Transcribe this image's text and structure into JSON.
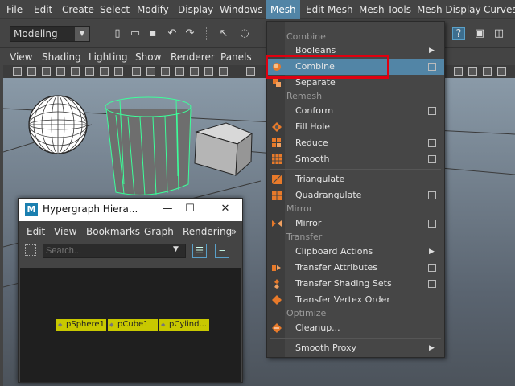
{
  "menubar": {
    "items": [
      "File",
      "Edit",
      "Create",
      "Select",
      "Modify",
      "Display",
      "Windows",
      "Mesh",
      "Edit Mesh",
      "Mesh Tools",
      "Mesh Display",
      "Curves"
    ],
    "active": "Mesh",
    "active_color": "#5285a6"
  },
  "toolbar": {
    "mode": "Modeling",
    "icons": [
      "new-scene-icon",
      "open-scene-icon",
      "save-scene-icon",
      "undo-icon",
      "redo-icon",
      "select-icon",
      "lasso-icon",
      "help-icon",
      "lock-icon"
    ]
  },
  "panel_menu": {
    "items": [
      "View",
      "Shading",
      "Lighting",
      "Show",
      "Renderer",
      "Panels"
    ]
  },
  "hypergraph": {
    "title": "Hypergraph Hiera...",
    "menu": [
      "Edit",
      "View",
      "Bookmarks",
      "Graph",
      "Rendering"
    ],
    "more": "»",
    "search_placeholder": "Search...",
    "nodes": [
      "pSphere1",
      "pCube1",
      "pCylind..."
    ],
    "node_color": "#c8c800"
  },
  "mesh_menu": {
    "sections": [
      {
        "title": "Combine",
        "items": [
          {
            "label": "Booleans",
            "option_box": false,
            "submenu": true,
            "icon": ""
          },
          {
            "label": "Combine",
            "option_box": true,
            "submenu": false,
            "icon": "combine-icon",
            "highlighted": true
          },
          {
            "label": "Separate",
            "option_box": false,
            "submenu": false,
            "icon": "separate-icon"
          }
        ]
      },
      {
        "title": "Remesh",
        "items": [
          {
            "label": "Conform",
            "option_box": true,
            "submenu": false,
            "icon": ""
          },
          {
            "label": "Fill Hole",
            "option_box": false,
            "submenu": false,
            "icon": "fill-hole-icon"
          },
          {
            "label": "Reduce",
            "option_box": true,
            "submenu": false,
            "icon": "reduce-icon"
          },
          {
            "label": "Smooth",
            "option_box": true,
            "submenu": false,
            "icon": "smooth-icon"
          },
          {
            "label": "Triangulate",
            "option_box": false,
            "submenu": false,
            "icon": "triangulate-icon"
          },
          {
            "label": "Quadrangulate",
            "option_box": true,
            "submenu": false,
            "icon": "quadrangulate-icon"
          }
        ]
      },
      {
        "title": "Mirror",
        "items": [
          {
            "label": "Mirror",
            "option_box": true,
            "submenu": false,
            "icon": "mirror-icon"
          }
        ]
      },
      {
        "title": "Transfer",
        "items": [
          {
            "label": "Clipboard Actions",
            "option_box": false,
            "submenu": true,
            "icon": ""
          },
          {
            "label": "Transfer Attributes",
            "option_box": true,
            "submenu": false,
            "icon": "transfer-attributes-icon"
          },
          {
            "label": "Transfer Shading Sets",
            "option_box": true,
            "submenu": false,
            "icon": "transfer-shading-sets-icon"
          },
          {
            "label": "Transfer Vertex Order",
            "option_box": false,
            "submenu": false,
            "icon": "transfer-vertex-order-icon"
          }
        ]
      },
      {
        "title": "Optimize",
        "items": [
          {
            "label": "Cleanup...",
            "option_box": false,
            "submenu": false,
            "icon": "cleanup-icon"
          },
          {
            "label": "Smooth Proxy",
            "option_box": false,
            "submenu": true,
            "icon": ""
          }
        ]
      }
    ],
    "highlight_color": "#5285a6",
    "callout_color": "#e00010"
  }
}
